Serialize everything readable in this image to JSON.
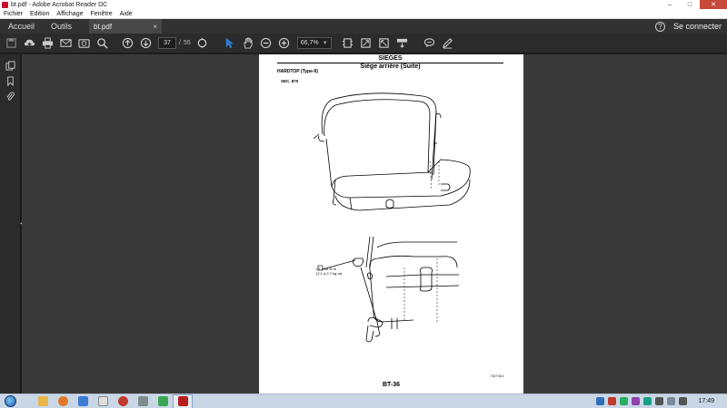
{
  "window": {
    "title": "bt.pdf - Adobe Acrobat Reader DC",
    "minimize_glyph": "–",
    "maximize_glyph": "□",
    "close_glyph": "✕"
  },
  "menu": [
    "Fichier",
    "Edition",
    "Affichage",
    "Fenêtre",
    "Aide"
  ],
  "nav": {
    "home": "Accueil",
    "tools": "Outils",
    "doc_tab": "bt.pdf",
    "doc_tab_close": "×",
    "help_glyph": "?",
    "sign_in": "Se connecter"
  },
  "toolbar": {
    "current_page": "37",
    "page_separator": "/",
    "total_pages": "55",
    "zoom": "66,7%",
    "icons": [
      "save-icon",
      "upload-icon",
      "print-icon",
      "email-icon",
      "camera-icon",
      "search-icon",
      "page-up-icon",
      "page-down-icon",
      "zoom-search-icon",
      "select-cursor-icon",
      "hand-icon",
      "zoom-out-icon",
      "zoom-in-icon",
      "fit-page-icon",
      "rotate-icon",
      "full-screen-icon",
      "scroll-mode-icon",
      "comment-icon",
      "sign-icon"
    ]
  },
  "left_rail": [
    "copy-pages-icon",
    "bookmark-icon",
    "attachment-icon"
  ],
  "document": {
    "header": "SIEGES",
    "subheader": "Siège arrière (Suite)",
    "section": "HARDTOP (Type-II)",
    "sec_label": "SEC. 870",
    "torque_line1": "21 à 26 N·m",
    "torque_line2": "(2,1 à 2,7 kg-m)",
    "figure_ref": "SBT563",
    "page_number": "BT-36"
  },
  "taskbar": {
    "apps": [
      {
        "name": "explorer",
        "color": "#e8b64a"
      },
      {
        "name": "media-player",
        "color": "#e07a2a"
      },
      {
        "name": "app-blue",
        "color": "#3a7bd5"
      },
      {
        "name": "app-doc",
        "color": "#dedede"
      },
      {
        "name": "app-red",
        "color": "#c0392b"
      },
      {
        "name": "app-gray",
        "color": "#7f8c8d"
      },
      {
        "name": "app-green",
        "color": "#3aa655"
      },
      {
        "name": "acrobat",
        "color": "#b71c1c"
      }
    ],
    "clock": "17:49"
  },
  "colors": {
    "toolbar_bg": "#2b2b2b",
    "nav_bg": "#323232",
    "doc_bg": "#393939",
    "accent_select": "#2d7fd8"
  }
}
